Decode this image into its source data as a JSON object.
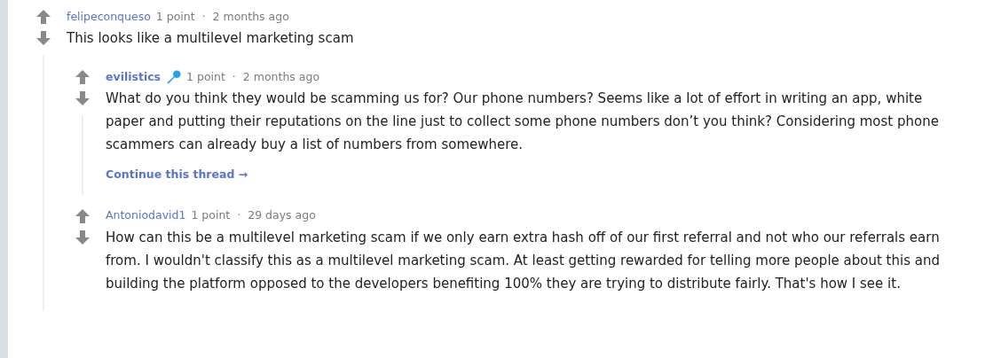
{
  "comments": [
    {
      "author": "felipeconqueso",
      "author_bold": false,
      "flair": false,
      "score": "1 point",
      "separator": "·",
      "time": "2 months ago",
      "body": "This looks like a multilevel marketing scam",
      "children": [
        {
          "author": "evilistics",
          "author_bold": true,
          "flair": true,
          "score": "1 point",
          "separator": "·",
          "time": "2 months ago",
          "body": "What do you think they would be scamming us for? Our phone numbers? Seems like a lot of effort in writing an app, white paper and putting their reputations on the line just to collect some phone numbers don’t you think? Considering most phone scammers can already buy a list of numbers from somewhere.",
          "continue_link": "Continue this thread →"
        },
        {
          "author": "Antoniodavid1",
          "author_bold": false,
          "flair": false,
          "score": "1 point",
          "separator": "·",
          "time": "29 days ago",
          "body": "How can this be a multilevel marketing scam if we only earn extra hash off of our first referral and not who our referrals earn from. I wouldn't classify this as a multilevel marketing scam. At least getting rewarded for telling more people about this and building the platform opposed to the developers benefiting 100% they are trying to distribute fairly. That's how I see it."
        }
      ]
    }
  ]
}
